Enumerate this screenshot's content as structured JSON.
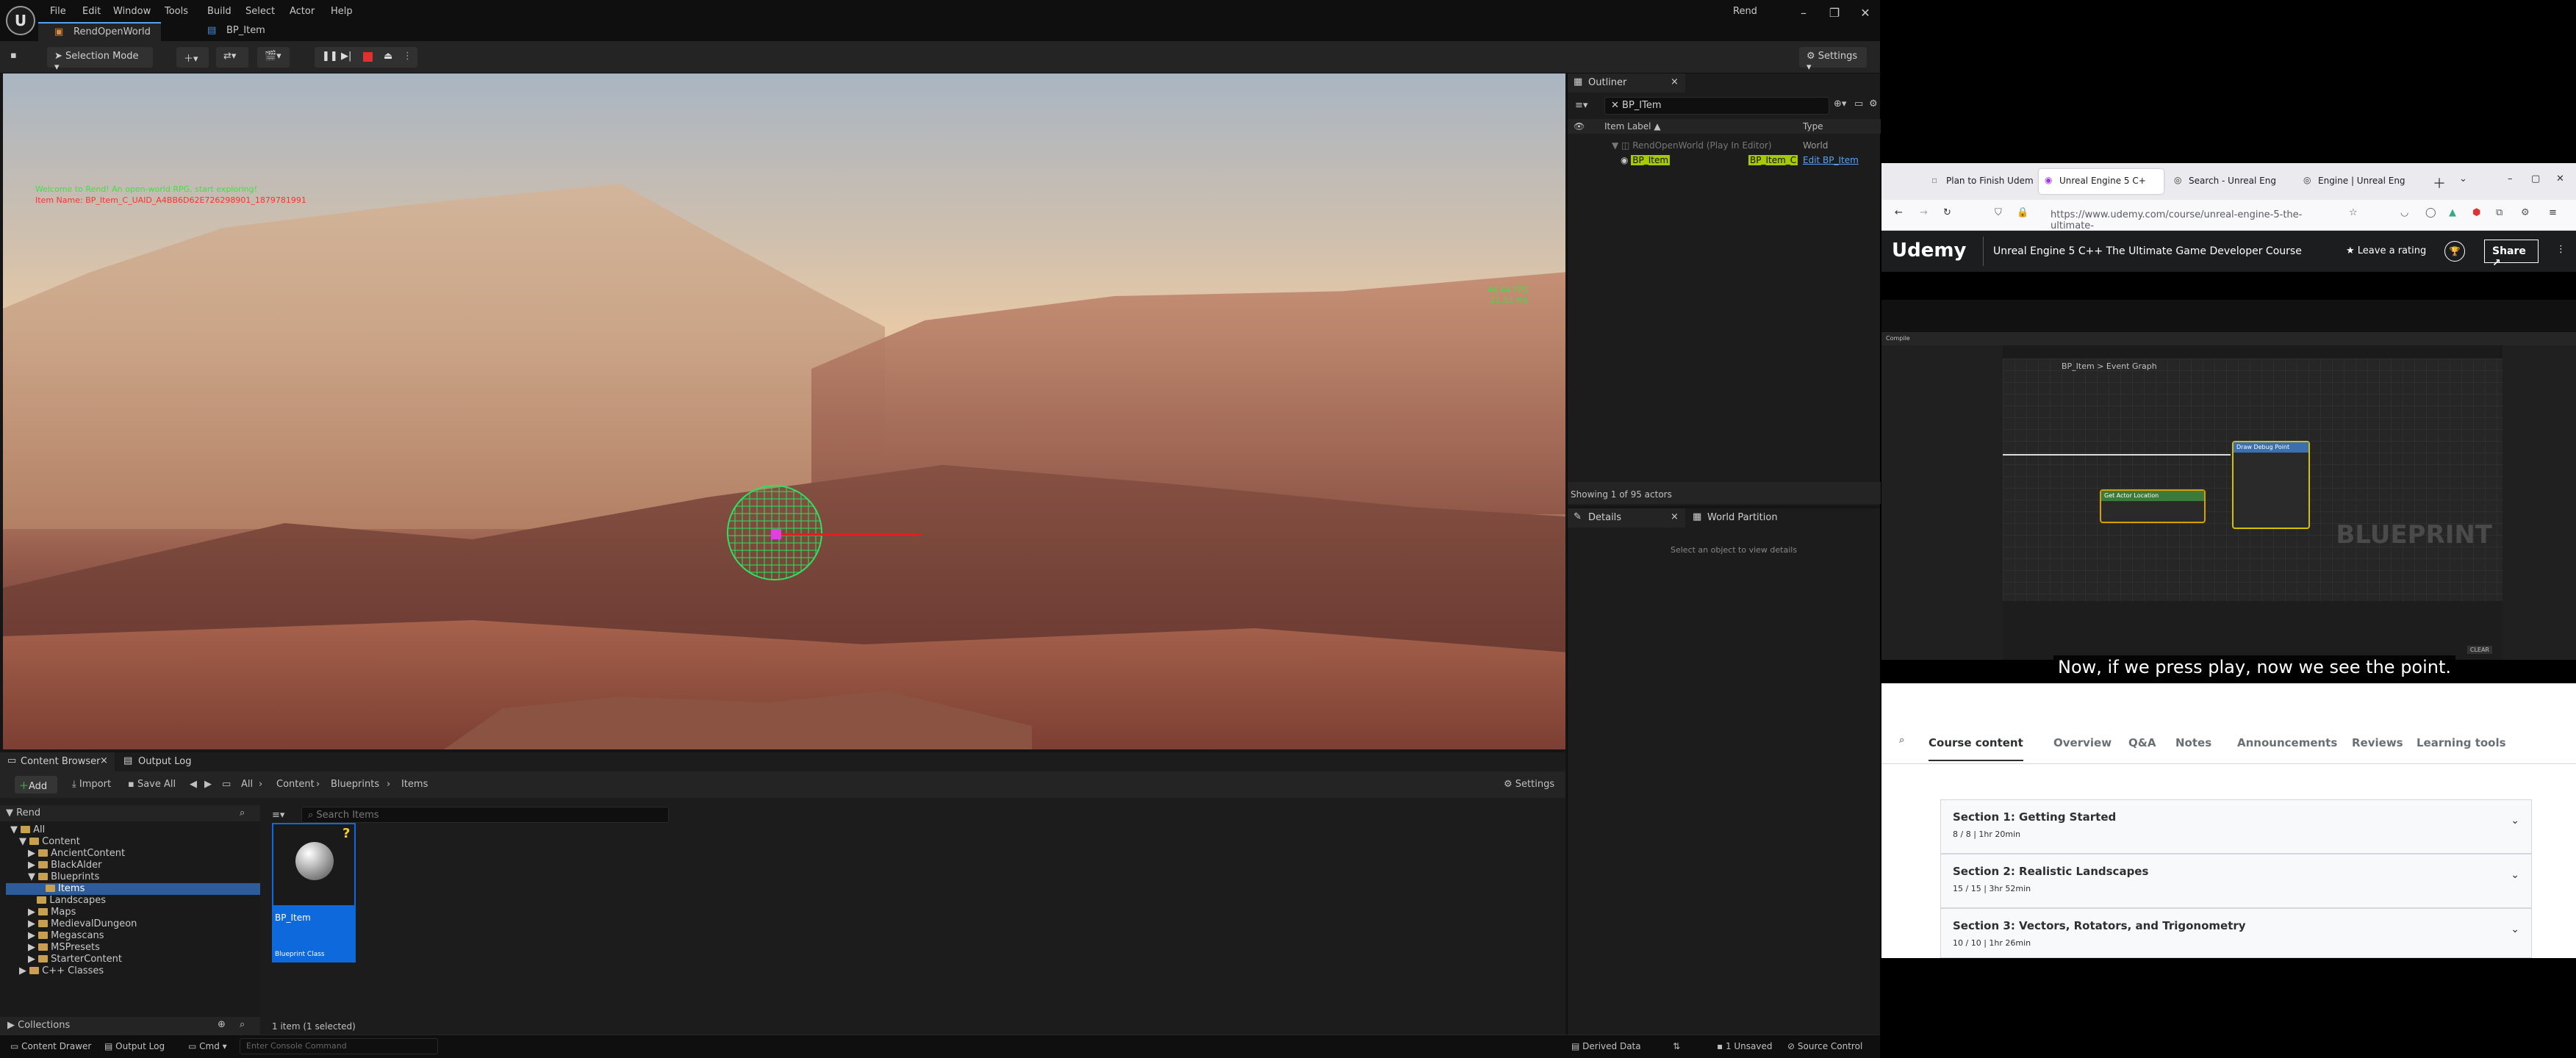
{
  "ue": {
    "menus": [
      "File",
      "Edit",
      "Window",
      "Tools",
      "Build",
      "Select",
      "Actor",
      "Help"
    ],
    "tabs": [
      "RendOpenWorld",
      "BP_Item"
    ],
    "project": "Rend",
    "toolbar": {
      "mode": "Selection Mode",
      "settings": "Settings"
    },
    "viewport": {
      "msg1": "Welcome to Rend! An open-world RPG, start exploring!",
      "msg2": "Item Name: BP_Item_C_UAID_A4BB6D62E726298901_1879781991",
      "fps": "46.44 FPS",
      "ms": "21.53 ms"
    },
    "outliner": {
      "tab": "Outliner",
      "search": "BP_ITem",
      "col_label": "Item Label",
      "col_type": "Type",
      "rows": [
        {
          "label": "RendOpenWorld (Play In Editor)",
          "type": "World"
        },
        {
          "label": "BP_Item",
          "type": "BP_Item_C",
          "action": "Edit BP_Item"
        }
      ],
      "count": "Showing 1 of 95 actors"
    },
    "details": {
      "tab": "Details",
      "tab2": "World Partition",
      "empty": "Select an object to view details"
    },
    "content_browser": {
      "tab": "Content Browser",
      "tab2": "Output Log",
      "add": "Add",
      "import": "Import",
      "save_all": "Save All",
      "path": [
        "All",
        "Content",
        "Blueprints",
        "Items"
      ],
      "settings": "Settings",
      "root": "Rend",
      "search_placeholder": "Search Items",
      "tree": [
        "All",
        "Content",
        "AncientContent",
        "BlackAlder",
        "Blueprints",
        "Items",
        "Landscapes",
        "Maps",
        "MedievalDungeon",
        "Megascans",
        "MSPresets",
        "StarterContent",
        "C++ Classes"
      ],
      "asset_name": "BP_Item",
      "asset_type": "Blueprint Class",
      "collections": "Collections",
      "status": "1 item (1 selected)"
    },
    "statusbar": {
      "content_drawer": "Content Drawer",
      "output_log": "Output Log",
      "cmd": "Cmd",
      "console_placeholder": "Enter Console Command",
      "derived": "Derived Data",
      "unsaved": "1 Unsaved",
      "source": "Source Control"
    }
  },
  "browser": {
    "tabs": [
      "Plan to Finish Udem",
      "Unreal Engine 5 C+",
      "Search - Unreal Eng",
      "Engine | Unreal Eng"
    ],
    "url": "https://www.udemy.com/course/unreal-engine-5-the-ultimate-",
    "brand": "Udemy",
    "course_title": "Unreal Engine 5 C++ The Ultimate Game Developer Course",
    "leave_rating": "Leave a rating",
    "share": "Share",
    "caption": "Now, if we press play, now we see the point.",
    "watermark": "BLUEPRINT",
    "course_nav": [
      "Course content",
      "Overview",
      "Q&A",
      "Notes",
      "Announcements",
      "Reviews",
      "Learning tools"
    ],
    "sections": [
      {
        "title": "Section 1: Getting Started",
        "sub": "8 / 8 | 1hr 20min"
      },
      {
        "title": "Section 2: Realistic Landscapes",
        "sub": "15 / 15 | 3hr 52min"
      },
      {
        "title": "Section 3: Vectors, Rotators, and Trigonometry",
        "sub": "10 / 10 | 1hr 26min"
      }
    ],
    "mini_editor": {
      "breadcrumb": "BP_Item > Event Graph",
      "node1": "Draw Debug Point",
      "node2": "Get Actor Location",
      "compile": "Compile",
      "clear": "CLEAR"
    }
  }
}
